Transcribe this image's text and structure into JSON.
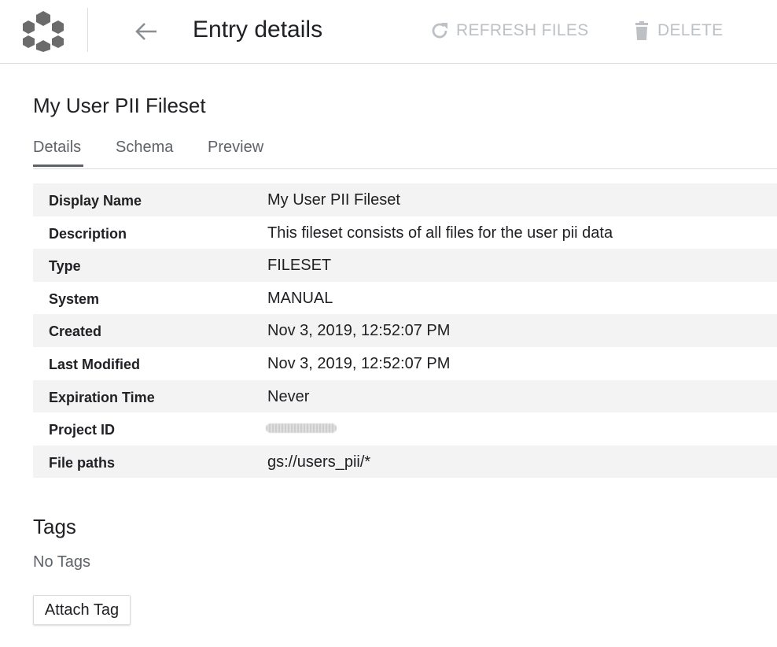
{
  "header": {
    "logo_icon": "data-catalog-hexagon-icon",
    "back_icon": "arrow-back-icon",
    "title": "Entry details",
    "refresh_label": "REFRESH FILES",
    "delete_label": "DELETE",
    "disabled_color": "#bdc1c6"
  },
  "entry": {
    "name": "My User PII Fileset"
  },
  "tabs": [
    {
      "label": "Details",
      "active": true
    },
    {
      "label": "Schema",
      "active": false
    },
    {
      "label": "Preview",
      "active": false
    }
  ],
  "details": [
    {
      "key": "Display Name",
      "value": "My User PII Fileset"
    },
    {
      "key": "Description",
      "value": "This fileset consists of all files for the user pii data"
    },
    {
      "key": "Type",
      "value": "FILESET"
    },
    {
      "key": "System",
      "value": "MANUAL"
    },
    {
      "key": "Created",
      "value": "Nov 3, 2019, 12:52:07 PM"
    },
    {
      "key": "Last Modified",
      "value": "Nov 3, 2019, 12:52:07 PM"
    },
    {
      "key": "Expiration Time",
      "value": "Never"
    },
    {
      "key": "Project ID",
      "value": ""
    },
    {
      "key": "File paths",
      "value": "gs://users_pii/*"
    }
  ],
  "tags": {
    "heading": "Tags",
    "empty_text": "No Tags",
    "attach_label": "Attach Tag"
  }
}
